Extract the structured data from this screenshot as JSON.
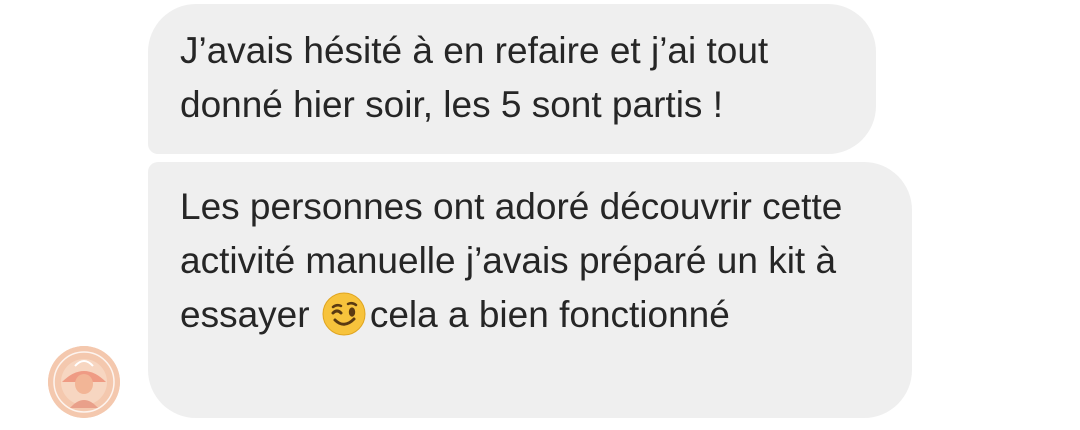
{
  "messages": [
    {
      "text": "J’avais hésité à en refaire et j’ai tout donné hier soir, les 5 sont partis !"
    },
    {
      "text_before_emoji": "Les personnes ont adoré découvrir cette activité manuelle j’avais préparé un kit à essayer ",
      "emoji": "winking-face",
      "text_after_emoji": "cela a bien fonctionné"
    }
  ],
  "colors": {
    "bubble_background": "#efefef",
    "text": "#262626",
    "emoji_face": "#f7c33c"
  }
}
